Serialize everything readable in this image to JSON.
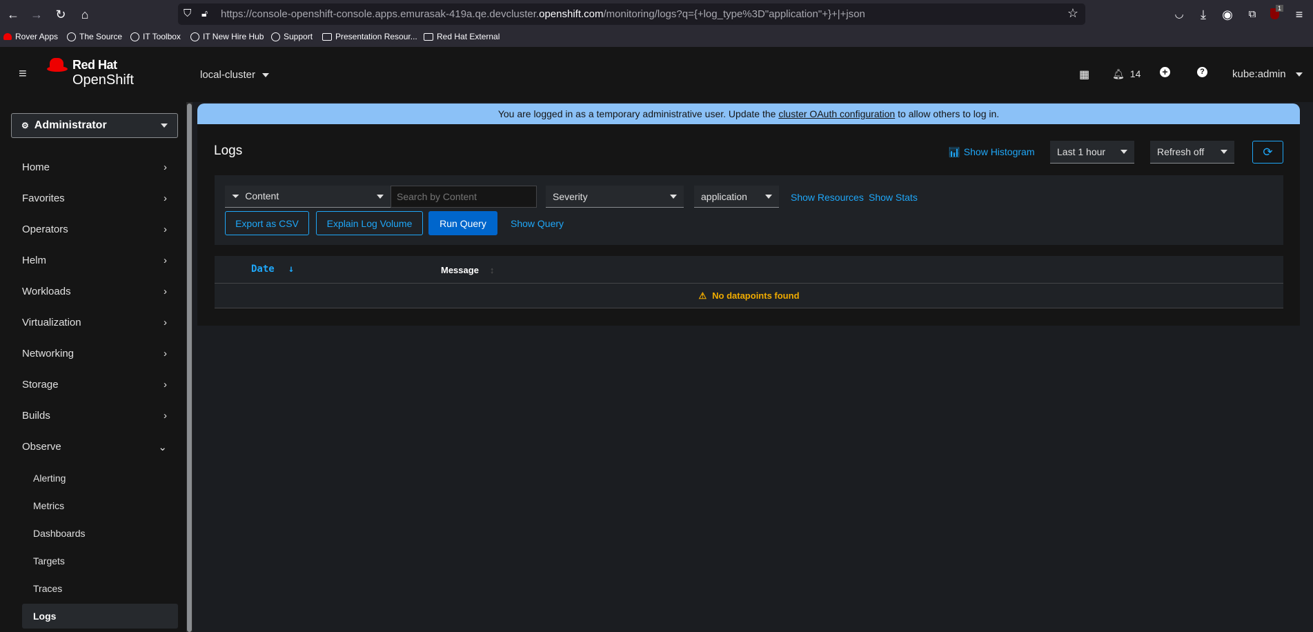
{
  "browser": {
    "url_prefix": "https://console-openshift-console.apps.emurasak-419a.qe.devcluster.",
    "url_domain": "openshift.com",
    "url_suffix": "/monitoring/logs?q={+log_type%3D\"application\"+}+|+json",
    "extension_badge": "1",
    "bookmarks": [
      "Rover Apps",
      "The Source",
      "IT Toolbox",
      "IT New Hire Hub",
      "Support",
      "Presentation Resour...",
      "Red Hat External"
    ]
  },
  "masthead": {
    "brand_line1": "Red Hat",
    "brand_line2": "OpenShift",
    "cluster": "local-cluster",
    "notifications": "14",
    "user": "kube:admin"
  },
  "sidebar": {
    "perspective": "Administrator",
    "items": [
      "Home",
      "Favorites",
      "Operators",
      "Helm",
      "Workloads",
      "Virtualization",
      "Networking",
      "Storage",
      "Builds",
      "Observe"
    ],
    "observe_items": [
      "Alerting",
      "Metrics",
      "Dashboards",
      "Targets",
      "Traces",
      "Logs"
    ],
    "active": "Logs"
  },
  "banner": {
    "text_before": "You are logged in as a temporary administrative user. Update the ",
    "link": "cluster OAuth configuration",
    "text_after": " to allow others to log in."
  },
  "logs": {
    "title": "Logs",
    "show_histogram": "Show Histogram",
    "time_range": "Last 1 hour",
    "refresh": "Refresh off",
    "filter_attribute": "Content",
    "search_placeholder": "Search by Content",
    "severity": "Severity",
    "tenant": "application",
    "show_resources": "Show Resources",
    "show_stats": "Show Stats",
    "export_csv": "Export as CSV",
    "explain_volume": "Explain Log Volume",
    "run_query": "Run Query",
    "show_query": "Show Query",
    "columns": [
      "Date",
      "Message"
    ],
    "empty": "No datapoints found"
  },
  "colors": {
    "accent": "#1fa7f8",
    "primary": "#0066cc",
    "warning": "#f0ab00",
    "banner": "#8bc1f7"
  }
}
